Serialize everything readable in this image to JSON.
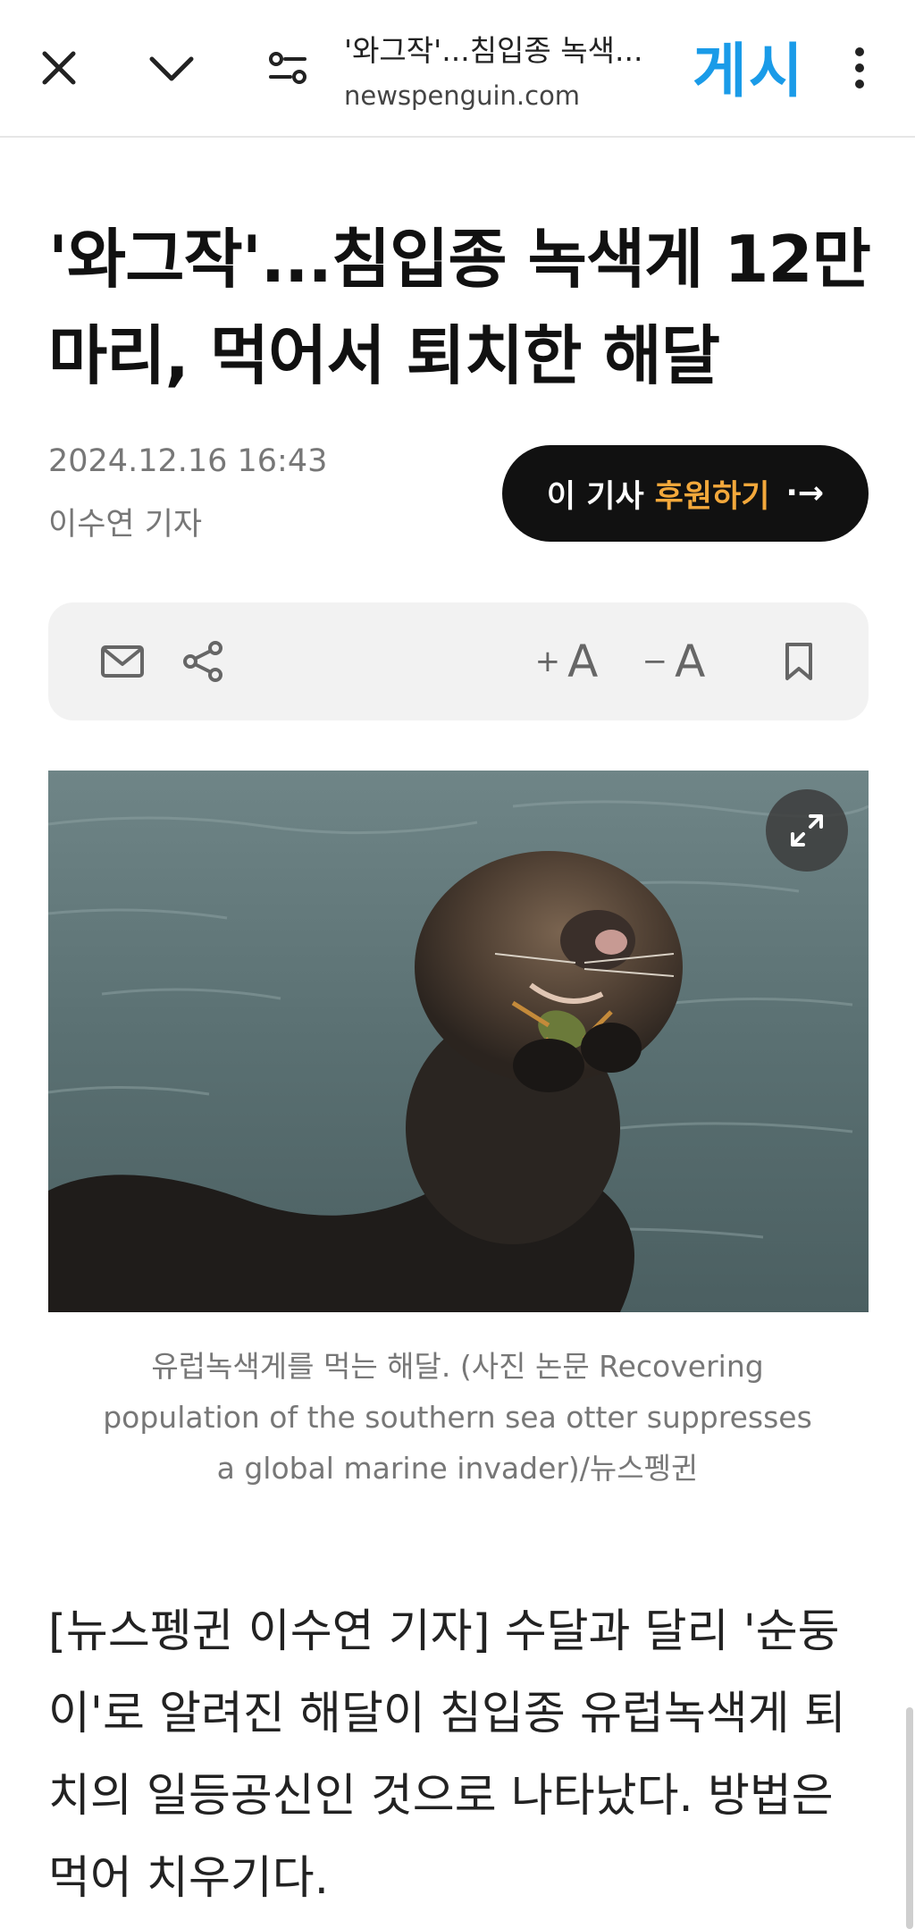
{
  "browser": {
    "tab_title": "'와그작'...침입종 녹색...",
    "url": "newspenguin.com",
    "brand": "게시",
    "icons": [
      "close-icon",
      "chevron-down-icon",
      "page-settings-icon",
      "more-vert-icon"
    ]
  },
  "article": {
    "headline": "'와그작'...침입종 녹색게 12만 마리, 먹어서 퇴치한 해달",
    "date": "2024.12.16 16:43",
    "author": "이수연 기자",
    "support_button": {
      "prefix": "이 기사",
      "accent": "후원하기",
      "arrow": "·→"
    },
    "tools": {
      "increase_font": "A",
      "decrease_font": "A",
      "plus_sign": "+",
      "minus_sign": "−"
    },
    "image_caption": "유럽녹색게를 먹는 해달. (사진 논문 Recovering population of the southern sea otter suppresses a global marine invader)/뉴스펭귄",
    "body": "[뉴스펭귄 이수연 기자] 수달과 달리 '순둥이'로 알려진 해달이 침입종 유럽녹색게 퇴치의 일등공신인 것으로 나타났다. 방법은 먹어 치우기다."
  },
  "colors": {
    "brand_blue": "#1a9be8",
    "support_accent": "#f3a83b",
    "button_dark": "#111111"
  }
}
